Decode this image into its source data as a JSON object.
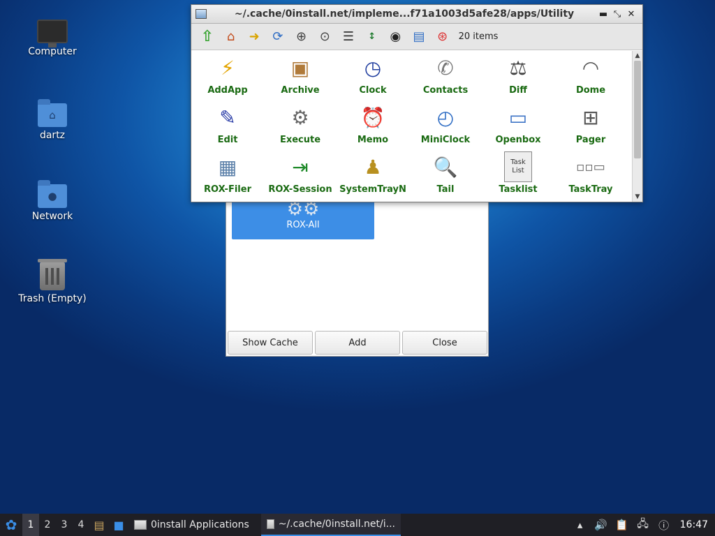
{
  "desktop": {
    "icons": [
      {
        "label": "Computer"
      },
      {
        "label": "dartz"
      },
      {
        "label": "Network"
      },
      {
        "label": "Trash (Empty)"
      }
    ]
  },
  "zeroinstall_dialog": {
    "selected_app": "ROX-All",
    "buttons": {
      "show_cache": "Show Cache",
      "add": "Add",
      "close": "Close"
    }
  },
  "rox_filer": {
    "title": "~/.cache/0install.net/impleme...f71a1003d5afe28/apps/Utility",
    "item_count": "20 items",
    "toolbar_icons": [
      "up-icon",
      "home-icon",
      "go-icon",
      "refresh-icon",
      "zoom-in-icon",
      "zoom-fit-icon",
      "details-icon",
      "sort-icon",
      "show-hidden-icon",
      "select-icon",
      "help-icon"
    ],
    "items": [
      {
        "name": "AddApp",
        "icon": "addapp-icon"
      },
      {
        "name": "Archive",
        "icon": "archive-icon"
      },
      {
        "name": "Clock",
        "icon": "clock-icon"
      },
      {
        "name": "Contacts",
        "icon": "contacts-icon"
      },
      {
        "name": "Diff",
        "icon": "diff-icon"
      },
      {
        "name": "Dome",
        "icon": "dome-icon"
      },
      {
        "name": "Edit",
        "icon": "edit-icon"
      },
      {
        "name": "Execute",
        "icon": "execute-icon"
      },
      {
        "name": "Memo",
        "icon": "memo-icon"
      },
      {
        "name": "MiniClock",
        "icon": "miniclock-icon"
      },
      {
        "name": "Openbox",
        "icon": "openbox-icon"
      },
      {
        "name": "Pager",
        "icon": "pager-icon"
      },
      {
        "name": "ROX-Filer",
        "icon": "rox-filer-icon"
      },
      {
        "name": "ROX-Session",
        "icon": "rox-session-icon"
      },
      {
        "name": "SystemTrayN",
        "icon": "systemtray-icon"
      },
      {
        "name": "Tail",
        "icon": "tail-icon"
      },
      {
        "name": "Tasklist",
        "icon": "tasklist-icon"
      },
      {
        "name": "TaskTray",
        "icon": "tasktray-icon"
      }
    ],
    "tasklist_icon_lines": [
      "Task",
      "List"
    ]
  },
  "taskbar": {
    "workspaces": [
      "1",
      "2",
      "3",
      "4"
    ],
    "tasks": [
      {
        "label": "0install Applications"
      },
      {
        "label": "~/.cache/0install.net/i..."
      }
    ],
    "clock": "16:47"
  }
}
